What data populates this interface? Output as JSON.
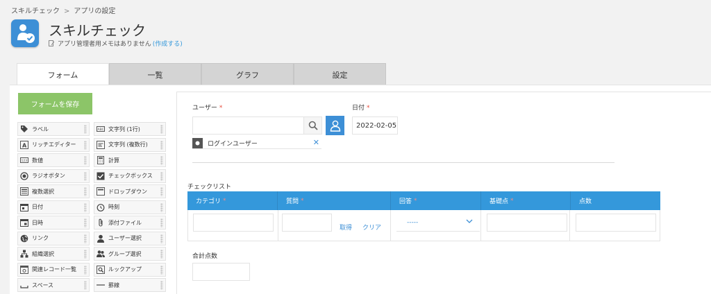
{
  "breadcrumb": {
    "app": "スキルチェック",
    "separator": ">",
    "current": "アプリの設定"
  },
  "header": {
    "title": "スキルチェック",
    "memo_text": "アプリ管理者用メモはありません",
    "memo_link": "(作成する)"
  },
  "tabs": [
    "フォーム",
    "一覧",
    "グラフ",
    "設定"
  ],
  "save_label": "フォームを保存",
  "palette": [
    {
      "label": "ラベル",
      "icon": "tag-icon"
    },
    {
      "label": "文字列 (1行)",
      "icon": "text-line-icon"
    },
    {
      "label": "リッチエディター",
      "icon": "rich-editor-icon"
    },
    {
      "label": "文字列 (複数行)",
      "icon": "text-multiline-icon"
    },
    {
      "label": "数値",
      "icon": "number-icon"
    },
    {
      "label": "計算",
      "icon": "calculator-icon"
    },
    {
      "label": "ラジオボタン",
      "icon": "radio-icon"
    },
    {
      "label": "チェックボックス",
      "icon": "checkbox-icon"
    },
    {
      "label": "複数選択",
      "icon": "multi-select-icon"
    },
    {
      "label": "ドロップダウン",
      "icon": "dropdown-icon"
    },
    {
      "label": "日付",
      "icon": "calendar-icon"
    },
    {
      "label": "時刻",
      "icon": "clock-icon"
    },
    {
      "label": "日時",
      "icon": "datetime-icon"
    },
    {
      "label": "添付ファイル",
      "icon": "paperclip-icon"
    },
    {
      "label": "リンク",
      "icon": "globe-icon"
    },
    {
      "label": "ユーザー選択",
      "icon": "user-icon"
    },
    {
      "label": "組織選択",
      "icon": "org-icon"
    },
    {
      "label": "グループ選択",
      "icon": "group-icon"
    },
    {
      "label": "関連レコード一覧",
      "icon": "related-records-icon"
    },
    {
      "label": "ルックアップ",
      "icon": "lookup-icon"
    },
    {
      "label": "スペース",
      "icon": "space-icon"
    },
    {
      "label": "罫線",
      "icon": "line-icon"
    }
  ],
  "form": {
    "user_label": "ユーザー",
    "date_label": "日付",
    "date_value": "2022-02-05",
    "required_mark": "*",
    "login_user": "ログインユーザー",
    "checklist_label": "チェックリスト",
    "columns": [
      "カテゴリ",
      "質問",
      "回答",
      "基礎点",
      "点数"
    ],
    "fetch_label": "取得",
    "clear_label": "クリア",
    "select_value": "-----",
    "total_label": "合計点数"
  },
  "colors": {
    "accent": "#3498db",
    "save": "#8cc568",
    "required": "#e74c3c"
  }
}
